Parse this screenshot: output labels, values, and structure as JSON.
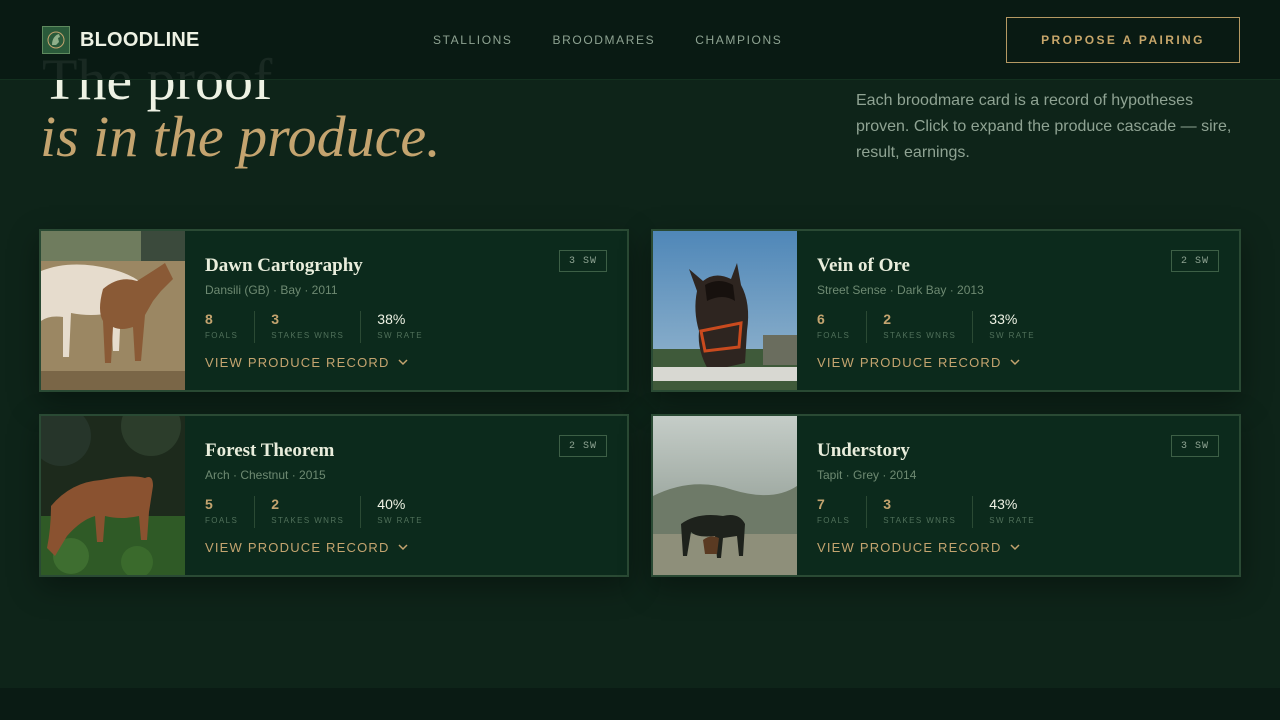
{
  "header": {
    "brand": "BLOODLINE",
    "nav": [
      "STALLIONS",
      "BROODMARES",
      "CHAMPIONS"
    ],
    "cta": "PROPOSE A PAIRING"
  },
  "hero": {
    "line1": "The proof",
    "line2": "is in the produce.",
    "description": "Each broodmare card is a record of hypotheses proven. Click to expand the produce cascade — sire, result, earnings."
  },
  "cards": [
    {
      "name": "Dawn Cartography",
      "meta": "Dansili (GB) · Bay · 2011",
      "badge": "3 SW",
      "stats": [
        {
          "value": "8",
          "label": "FOALS"
        },
        {
          "value": "3",
          "label": "STAKES WNRS"
        },
        {
          "value": "38%",
          "label": "SW RATE"
        }
      ],
      "expand": "VIEW PRODUCE RECORD"
    },
    {
      "name": "Vein of Ore",
      "meta": "Street Sense · Dark Bay · 2013",
      "badge": "2 SW",
      "stats": [
        {
          "value": "6",
          "label": "FOALS"
        },
        {
          "value": "2",
          "label": "STAKES WNRS"
        },
        {
          "value": "33%",
          "label": "SW RATE"
        }
      ],
      "expand": "VIEW PRODUCE RECORD"
    },
    {
      "name": "Forest Theorem",
      "meta": "Arch · Chestnut · 2015",
      "badge": "2 SW",
      "stats": [
        {
          "value": "5",
          "label": "FOALS"
        },
        {
          "value": "2",
          "label": "STAKES WNRS"
        },
        {
          "value": "40%",
          "label": "SW RATE"
        }
      ],
      "expand": "VIEW PRODUCE RECORD"
    },
    {
      "name": "Understory",
      "meta": "Tapit · Grey · 2014",
      "badge": "3 SW",
      "stats": [
        {
          "value": "7",
          "label": "FOALS"
        },
        {
          "value": "3",
          "label": "STAKES WNRS"
        },
        {
          "value": "43%",
          "label": "SW RATE"
        }
      ],
      "expand": "VIEW PRODUCE RECORD"
    }
  ],
  "icons": {
    "brand": "horse-emblem-icon",
    "expand": "chevron-down-icon"
  },
  "colors": {
    "background": "#0e2419",
    "accent_gold": "#c4a46f",
    "card_border": "#2a4a34"
  }
}
